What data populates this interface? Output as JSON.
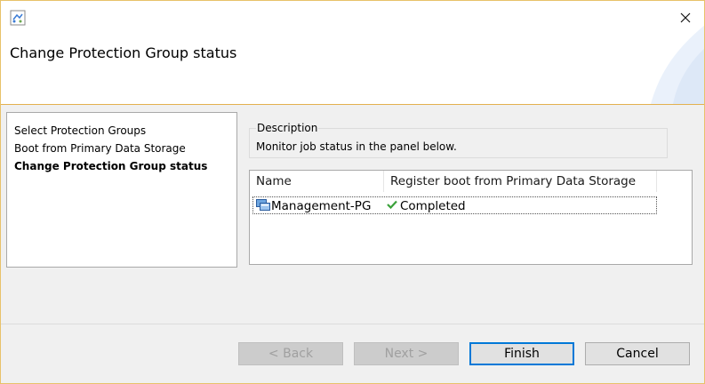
{
  "window": {
    "title": "Change Protection Group status",
    "close_icon": "close-icon",
    "app_icon": "wizard-app-icon"
  },
  "steps": [
    {
      "label": "Select Protection Groups",
      "current": false
    },
    {
      "label": "Boot from Primary Data Storage",
      "current": false
    },
    {
      "label": "Change Protection Group status",
      "current": true
    }
  ],
  "description": {
    "legend": "Description",
    "text": "Monitor job status in the panel below."
  },
  "grid": {
    "columns": [
      "Name",
      "Register boot from Primary Data Storage"
    ],
    "rows": [
      {
        "name": "Management-PG",
        "status": "Completed",
        "name_icon": "protection-group-icon",
        "status_icon": "check-icon"
      }
    ]
  },
  "buttons": {
    "back": {
      "label": "< Back",
      "enabled": false
    },
    "next": {
      "label": "Next >",
      "enabled": false
    },
    "finish": {
      "label": "Finish",
      "enabled": true
    },
    "cancel": {
      "label": "Cancel",
      "enabled": true
    }
  },
  "colors": {
    "accent": "#0078d7",
    "window_border": "#e8c26a",
    "check": "#3aa13a"
  }
}
